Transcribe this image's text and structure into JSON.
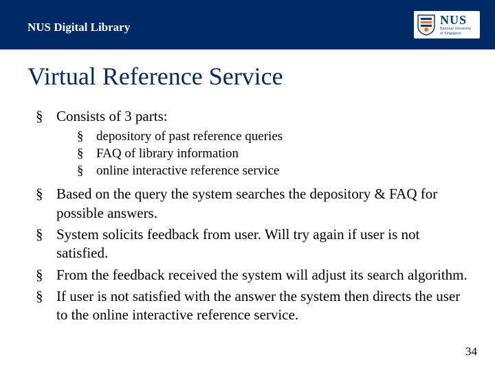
{
  "header": {
    "title": "NUS Digital Library",
    "logo": {
      "main": "NUS",
      "sub1": "National University",
      "sub2": "of Singapore"
    }
  },
  "slide": {
    "title": "Virtual Reference Service",
    "page_number": "34",
    "bullets": [
      {
        "text": "Consists of 3 parts:",
        "sub": [
          "depository of past reference queries",
          "FAQ of library information",
          "online  interactive reference service"
        ]
      },
      {
        "text": "Based on the query the system searches the depository & FAQ for possible answers."
      },
      {
        "text": "System solicits feedback from user.  Will try again if user is not satisfied."
      },
      {
        "text": "From the feedback received the system will adjust its search algorithm."
      },
      {
        "text": "If user is not satisfied with the answer the system then directs the user to the online interactive reference service."
      }
    ]
  }
}
